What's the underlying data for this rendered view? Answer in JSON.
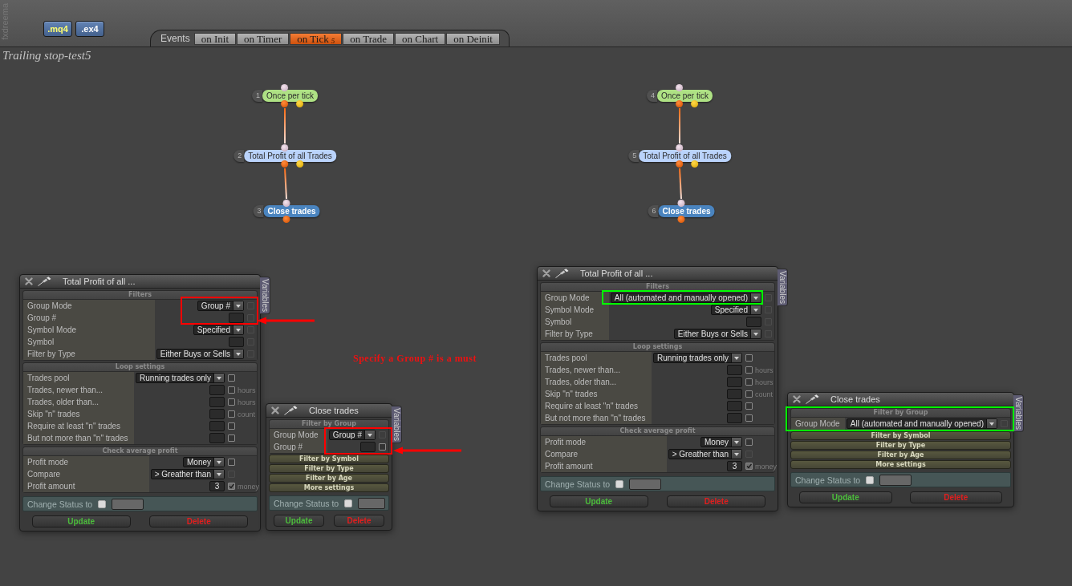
{
  "app": {
    "logo": "fxdreema"
  },
  "file_buttons": [
    {
      "label": ".mq4",
      "kind": "source"
    },
    {
      "label": ".ex4",
      "kind": "compiled"
    }
  ],
  "events": {
    "label": "Events",
    "tabs": [
      {
        "label": "on Init",
        "selected": false
      },
      {
        "label": "on Timer",
        "selected": false
      },
      {
        "label": "on Tick",
        "selected": true,
        "badge": "5"
      },
      {
        "label": "on Trade",
        "selected": false
      },
      {
        "label": "on Chart",
        "selected": false
      },
      {
        "label": "on Deinit",
        "selected": false
      }
    ]
  },
  "project": {
    "title": "Trailing stop-test5"
  },
  "chains": [
    {
      "nodes": [
        {
          "number": "1",
          "label": "Once per tick",
          "kind": "condition",
          "color": "#aee184"
        },
        {
          "number": "2",
          "label": "Total Profit of all Trades",
          "kind": "condition",
          "color": "#bad3fb"
        },
        {
          "number": "3",
          "label": "Close trades",
          "kind": "action",
          "color": "#4a84bf"
        }
      ]
    },
    {
      "nodes": [
        {
          "number": "4",
          "label": "Once per tick",
          "kind": "condition",
          "color": "#aee184"
        },
        {
          "number": "5",
          "label": "Total Profit of all Trades",
          "kind": "condition",
          "color": "#bad3fb"
        },
        {
          "number": "6",
          "label": "Close trades",
          "kind": "action",
          "color": "#4a84bf"
        }
      ]
    }
  ],
  "panels": [
    {
      "title": "Total Profit of all ...",
      "side_tab": "Variables",
      "sections": [
        {
          "title": "Filters",
          "expanded": true,
          "rows": [
            {
              "label": "Group Mode",
              "kind": "dropdown",
              "value": "Group #",
              "checkbox": {
                "checked": false,
                "disabled": true
              }
            },
            {
              "label": "Group #",
              "kind": "input",
              "checkbox": {
                "checked": false,
                "disabled": true
              }
            },
            {
              "label": "Symbol Mode",
              "kind": "dropdown",
              "value": "Specified",
              "checkbox": {
                "checked": false,
                "disabled": true
              }
            },
            {
              "label": "Symbol",
              "kind": "input",
              "checkbox": {
                "checked": false,
                "disabled": true
              }
            },
            {
              "label": "Filter by Type",
              "kind": "dropdown",
              "value": "Either Buys or Sells",
              "checkbox": {
                "checked": false,
                "disabled": true
              }
            }
          ]
        },
        {
          "title": "Loop settings",
          "expanded": true,
          "rows": [
            {
              "label": "Trades pool",
              "kind": "dropdown",
              "value": "Running trades only",
              "checkbox": {
                "checked": false,
                "disabled": false
              }
            },
            {
              "label": "Trades, newer than...",
              "kind": "input",
              "unit": "hours",
              "checkbox": {
                "checked": false,
                "disabled": false
              }
            },
            {
              "label": "Trades, older than...",
              "kind": "input",
              "unit": "hours",
              "checkbox": {
                "checked": false,
                "disabled": false
              }
            },
            {
              "label": "Skip \"n\" trades",
              "kind": "input",
              "unit": "count",
              "checkbox": {
                "checked": false,
                "disabled": false
              }
            },
            {
              "label": "Require at least \"n\" trades",
              "kind": "input",
              "checkbox": {
                "checked": false,
                "disabled": false
              }
            },
            {
              "label": "But not more than \"n\" trades",
              "kind": "input",
              "checkbox": {
                "checked": false,
                "disabled": false
              }
            }
          ]
        },
        {
          "title": "Check average profit",
          "expanded": true,
          "rows": [
            {
              "label": "Profit mode",
              "kind": "dropdown",
              "value": "Money",
              "checkbox": {
                "checked": false,
                "disabled": false
              }
            },
            {
              "label": "Compare",
              "kind": "dropdown",
              "value": "> Greather than",
              "checkbox": {
                "checked": false,
                "disabled": true
              }
            },
            {
              "label": "Profit amount",
              "kind": "input",
              "value": "3",
              "unit": "money",
              "checkbox": {
                "checked": true,
                "disabled": false
              }
            }
          ]
        }
      ],
      "status": {
        "label": "Change Status to",
        "checked": false
      },
      "buttons": [
        {
          "label": "Update",
          "kind": "update"
        },
        {
          "label": "Delete",
          "kind": "delete"
        }
      ]
    },
    {
      "title": "Close trades",
      "side_tab": "Variables",
      "sections": [
        {
          "title": "Filter by Group",
          "expanded": true,
          "rows": [
            {
              "label": "Group Mode",
              "kind": "dropdown",
              "value": "Group #",
              "checkbox": {
                "checked": false,
                "disabled": true
              }
            },
            {
              "label": "Group #",
              "kind": "input",
              "checkbox": {
                "checked": false,
                "disabled": false
              }
            }
          ]
        },
        {
          "title": "Filter by Symbol",
          "expanded": false
        },
        {
          "title": "Filter by Type",
          "expanded": false
        },
        {
          "title": "Filter by Age",
          "expanded": false
        },
        {
          "title": "More settings",
          "expanded": false
        }
      ],
      "status": {
        "label": "Change Status to",
        "checked": false
      },
      "buttons": [
        {
          "label": "Update",
          "kind": "update"
        },
        {
          "label": "Delete",
          "kind": "delete"
        }
      ]
    },
    {
      "title": "Total Profit of all ...",
      "side_tab": "Variables",
      "sections": [
        {
          "title": "Filters",
          "expanded": true,
          "rows": [
            {
              "label": "Group Mode",
              "kind": "dropdown",
              "value": "All (automated and manually opened)",
              "checkbox": {
                "checked": false,
                "disabled": true
              }
            },
            {
              "label": "Symbol Mode",
              "kind": "dropdown",
              "value": "Specified",
              "checkbox": {
                "checked": false,
                "disabled": true
              }
            },
            {
              "label": "Symbol",
              "kind": "input",
              "checkbox": {
                "checked": false,
                "disabled": true
              }
            },
            {
              "label": "Filter by Type",
              "kind": "dropdown",
              "value": "Either Buys or Sells",
              "checkbox": {
                "checked": false,
                "disabled": true
              }
            }
          ]
        },
        {
          "title": "Loop settings",
          "expanded": true,
          "rows": [
            {
              "label": "Trades pool",
              "kind": "dropdown",
              "value": "Running trades only",
              "checkbox": {
                "checked": false,
                "disabled": false
              }
            },
            {
              "label": "Trades, newer than...",
              "kind": "input",
              "unit": "hours",
              "checkbox": {
                "checked": false,
                "disabled": false
              }
            },
            {
              "label": "Trades, older than...",
              "kind": "input",
              "unit": "hours",
              "checkbox": {
                "checked": false,
                "disabled": false
              }
            },
            {
              "label": "Skip \"n\" trades",
              "kind": "input",
              "unit": "count",
              "checkbox": {
                "checked": false,
                "disabled": false
              }
            },
            {
              "label": "Require at least \"n\" trades",
              "kind": "input",
              "checkbox": {
                "checked": false,
                "disabled": false
              }
            },
            {
              "label": "But not more than \"n\" trades",
              "kind": "input",
              "checkbox": {
                "checked": false,
                "disabled": false
              }
            }
          ]
        },
        {
          "title": "Check average profit",
          "expanded": true,
          "rows": [
            {
              "label": "Profit mode",
              "kind": "dropdown",
              "value": "Money",
              "checkbox": {
                "checked": false,
                "disabled": false
              }
            },
            {
              "label": "Compare",
              "kind": "dropdown",
              "value": "> Greather than",
              "checkbox": {
                "checked": false,
                "disabled": true
              }
            },
            {
              "label": "Profit amount",
              "kind": "input",
              "value": "3",
              "unit": "money",
              "checkbox": {
                "checked": true,
                "disabled": false
              }
            }
          ]
        }
      ],
      "status": {
        "label": "Change Status to",
        "checked": false
      },
      "buttons": [
        {
          "label": "Update",
          "kind": "update"
        },
        {
          "label": "Delete",
          "kind": "delete"
        }
      ]
    },
    {
      "title": "Close trades",
      "side_tab": "Variables",
      "sections": [
        {
          "title": "Filter by Group",
          "expanded": true,
          "rows": [
            {
              "label": "Group Mode",
              "kind": "dropdown",
              "value": "All (automated and manually opened)",
              "checkbox": {
                "checked": false,
                "disabled": true
              }
            }
          ]
        },
        {
          "title": "Filter by Symbol",
          "expanded": false
        },
        {
          "title": "Filter by Type",
          "expanded": false
        },
        {
          "title": "Filter by Age",
          "expanded": false
        },
        {
          "title": "More settings",
          "expanded": false
        }
      ],
      "status": {
        "label": "Change Status to",
        "checked": false
      },
      "buttons": [
        {
          "label": "Update",
          "kind": "update"
        },
        {
          "label": "Delete",
          "kind": "delete"
        }
      ]
    }
  ],
  "annotations": [
    {
      "kind": "frame",
      "color": "#ff0000"
    },
    {
      "kind": "arrow",
      "color": "#ff0000"
    },
    {
      "kind": "note",
      "color": "#ee1111",
      "text": "Specify a Group # is a must"
    },
    {
      "kind": "frame",
      "color": "#ff0000"
    },
    {
      "kind": "arrow",
      "color": "#ff0000"
    },
    {
      "kind": "frame",
      "color": "#00ff00"
    },
    {
      "kind": "frame",
      "color": "#00ff00"
    }
  ]
}
